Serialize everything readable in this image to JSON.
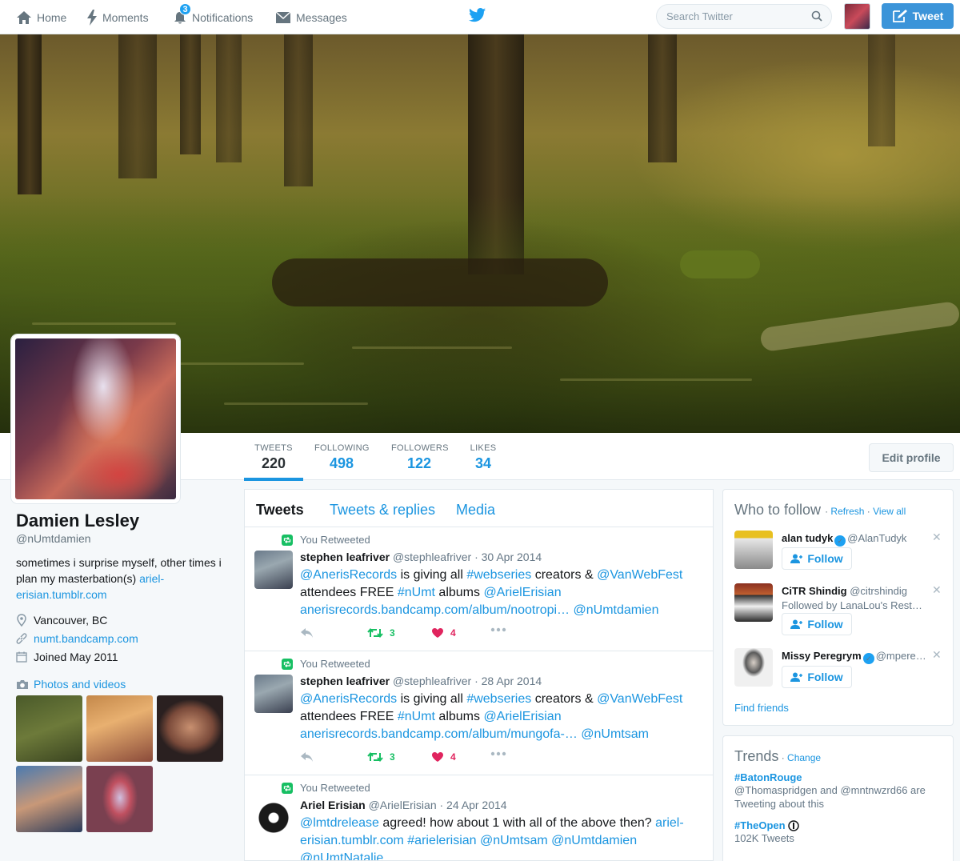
{
  "nav": {
    "home": "Home",
    "moments": "Moments",
    "notifications": "Notifications",
    "notifications_count": "3",
    "messages": "Messages",
    "search_placeholder": "Search Twitter",
    "tweet_button": "Tweet"
  },
  "profile": {
    "name": "Damien Lesley",
    "handle": "@nUmtdamien",
    "bio_text": "sometimes i surprise myself, other times i plan my masterbation(s) ",
    "bio_link": "ariel-erisian.tumblr.com",
    "location": "Vancouver, BC",
    "website": "numt.bandcamp.com",
    "joined": "Joined May 2011",
    "photos_label": "Photos and videos"
  },
  "stats": [
    {
      "label": "TWEETS",
      "value": "220"
    },
    {
      "label": "FOLLOWING",
      "value": "498"
    },
    {
      "label": "FOLLOWERS",
      "value": "122"
    },
    {
      "label": "LIKES",
      "value": "34"
    }
  ],
  "edit_profile": "Edit profile",
  "tabs": [
    "Tweets",
    "Tweets & replies",
    "Media"
  ],
  "tweets": [
    {
      "rt_label": "You Retweeted",
      "name": "stephen leafriver",
      "meta": "@stephleafriver · 30 Apr 2014",
      "p1": "@AnerisRecords",
      "p2": " is giving all ",
      "p3": "#webseries",
      "p4": " creators & ",
      "p5": "@VanWebFest",
      "p6": " attendees FREE ",
      "p7": "#nUmt",
      "p8": " albums ",
      "p9": "@ArielErisian",
      "p10": "anerisrecords.bandcamp.com/album/nootropi…",
      "p11": "@nUmtdamien",
      "retweets": "3",
      "likes": "4"
    },
    {
      "rt_label": "You Retweeted",
      "name": "stephen leafriver",
      "meta": "@stephleafriver · 28 Apr 2014",
      "p1": "@AnerisRecords",
      "p2": " is giving all ",
      "p3": "#webseries",
      "p4": " creators & ",
      "p5": "@VanWebFest",
      "p6": " attendees FREE ",
      "p7": "#nUmt",
      "p8": " albums ",
      "p9": "@ArielErisian",
      "p10": "anerisrecords.bandcamp.com/album/mungofa-…",
      "p11": "@nUmtsam",
      "retweets": "3",
      "likes": "4"
    },
    {
      "rt_label": "You Retweeted",
      "name": "Ariel Erisian",
      "meta": "@ArielErisian · 24 Apr 2014",
      "p1": "@lmtdrelease",
      "p2": " agreed! how about 1 with all of the above then? ",
      "p3": "ariel-erisian.tumblr.com",
      "p4": "#arielerisian",
      "p5": "@nUmtsam",
      "p6": "@nUmtdamien",
      "p7": "@nUmtNatalie"
    }
  ],
  "who_to_follow": {
    "title": "Who to follow",
    "refresh": "Refresh",
    "view_all": "View all",
    "follow_label": "Follow",
    "find_friends": "Find friends",
    "users": [
      {
        "name": "alan tudyk",
        "handle": "@AlanTudyk",
        "sub": ""
      },
      {
        "name": "CiTR Shindig",
        "handle": "@citrshindig",
        "sub": "Followed by LanaLou's Rest…"
      },
      {
        "name": "Missy Peregrym",
        "handle": "@mpere…",
        "sub": ""
      }
    ]
  },
  "trends": {
    "title": "Trends",
    "change": "Change",
    "items": [
      {
        "tag": "#BatonRouge",
        "desc": "@Thomaspridgen and @mntnwzrd66 are Tweeting about this"
      },
      {
        "tag": "#TheOpen",
        "desc": "102K Tweets"
      }
    ]
  },
  "colors": {
    "accent": "#1b95e0",
    "tweet_button": "#3b94d9",
    "retweet": "#17bf63",
    "like": "#e0245e"
  }
}
